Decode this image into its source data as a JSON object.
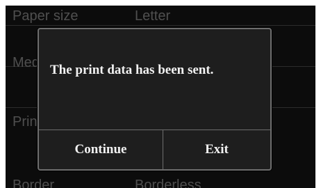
{
  "settings": {
    "rows": [
      {
        "label": "Paper size",
        "value": "Letter"
      },
      {
        "label": "Media type",
        "value": ""
      },
      {
        "label": "Print quality",
        "value": ""
      },
      {
        "label": "Border",
        "value": "Borderless"
      }
    ]
  },
  "dialog": {
    "message": "The print data has been sent.",
    "continue_label": "Continue",
    "exit_label": "Exit"
  }
}
